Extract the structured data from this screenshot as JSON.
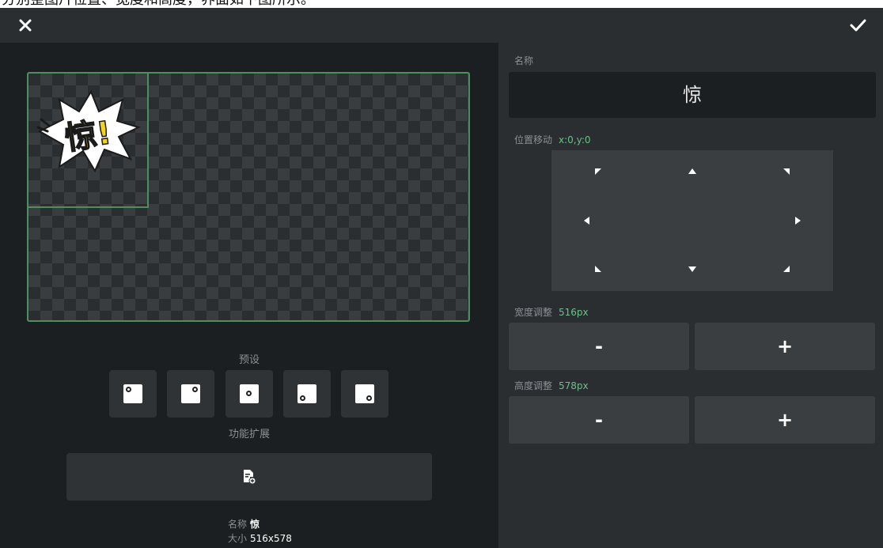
{
  "caption": {
    "text": "分别整图片位置、宽度和高度，界面如下图所示。"
  },
  "topbar": {
    "close_icon": "close-icon",
    "confirm_icon": "check-icon"
  },
  "canvas": {
    "sticker_text": "惊!"
  },
  "presets": {
    "label": "预设",
    "items": [
      "top-left",
      "top-right",
      "center",
      "bottom-left",
      "bottom-right"
    ]
  },
  "extension": {
    "label": "功能扩展",
    "icon": "file-add-icon"
  },
  "info": {
    "name_label": "名称",
    "name_value": "惊",
    "size_label": "大小",
    "size_value": "516x578"
  },
  "name_section": {
    "label": "名称",
    "value": "惊"
  },
  "move_section": {
    "label": "位置移动",
    "value": "x:0,y:0"
  },
  "width_section": {
    "label": "宽度调整",
    "value": "516px",
    "minus": "-",
    "plus": "+"
  },
  "height_section": {
    "label": "高度调整",
    "value": "578px",
    "minus": "-",
    "plus": "+"
  },
  "colors": {
    "accent": "#6cc08a",
    "canvas_border": "#4e8f62",
    "background": "#1c1f21",
    "panel": "#2a2e31"
  }
}
